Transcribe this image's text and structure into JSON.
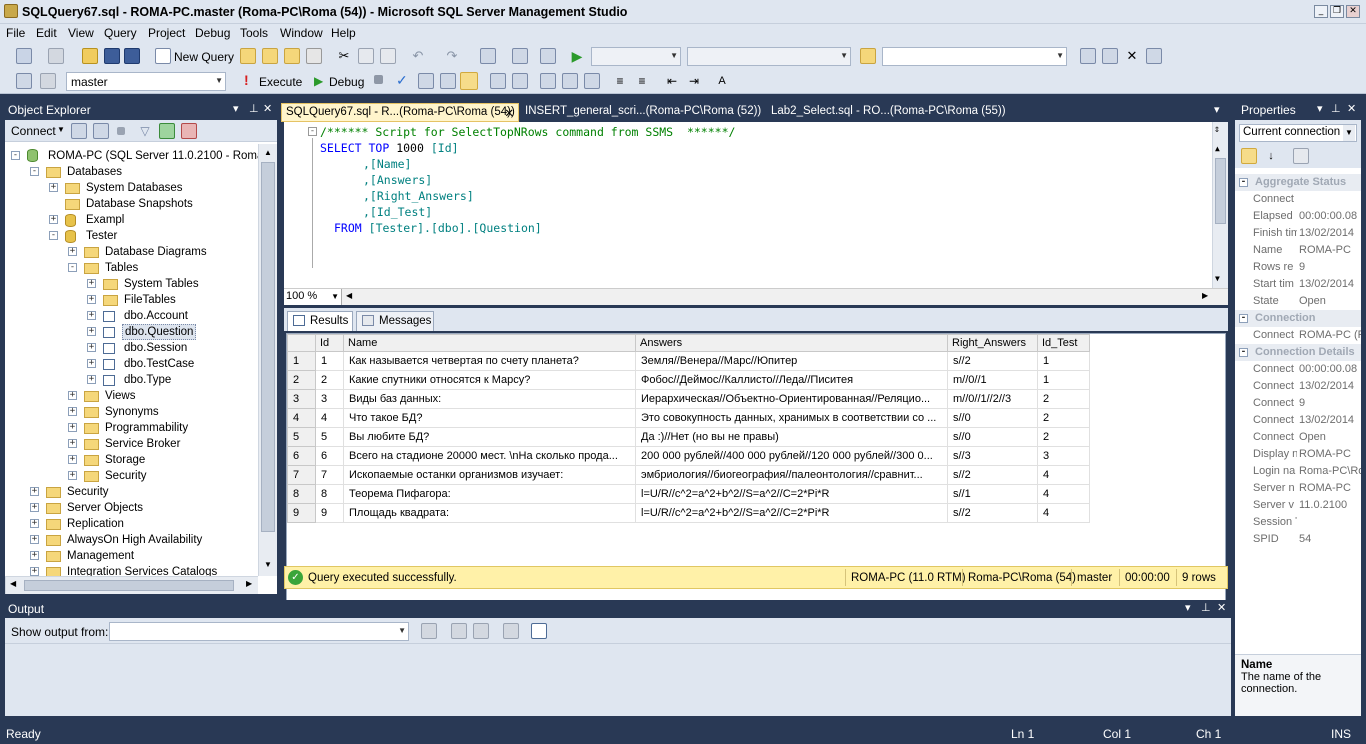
{
  "window": {
    "title": "SQLQuery67.sql - ROMA-PC.master (Roma-PC\\Roma (54)) - Microsoft SQL Server Management Studio"
  },
  "menu": [
    "File",
    "Edit",
    "View",
    "Query",
    "Project",
    "Debug",
    "Tools",
    "Window",
    "Help"
  ],
  "toolbar": {
    "new_query": "New Query",
    "database": "master",
    "execute": "Execute",
    "debug": "Debug"
  },
  "object_explorer": {
    "title": "Object Explorer",
    "connect": "Connect",
    "tree": [
      {
        "label": "ROMA-PC (SQL Server 11.0.2100 - Roma-P",
        "indent": 0,
        "exp": "-",
        "icon": "server"
      },
      {
        "label": "Databases",
        "indent": 1,
        "exp": "-",
        "icon": "folder"
      },
      {
        "label": "System Databases",
        "indent": 2,
        "exp": "+",
        "icon": "folder"
      },
      {
        "label": "Database Snapshots",
        "indent": 2,
        "exp": "",
        "icon": "folder"
      },
      {
        "label": "Exampl",
        "indent": 2,
        "exp": "+",
        "icon": "db"
      },
      {
        "label": "Tester",
        "indent": 2,
        "exp": "-",
        "icon": "db"
      },
      {
        "label": "Database Diagrams",
        "indent": 3,
        "exp": "+",
        "icon": "folder"
      },
      {
        "label": "Tables",
        "indent": 3,
        "exp": "-",
        "icon": "folder"
      },
      {
        "label": "System Tables",
        "indent": 4,
        "exp": "+",
        "icon": "folder"
      },
      {
        "label": "FileTables",
        "indent": 4,
        "exp": "+",
        "icon": "folder"
      },
      {
        "label": "dbo.Account",
        "indent": 4,
        "exp": "+",
        "icon": "table"
      },
      {
        "label": "dbo.Question",
        "indent": 4,
        "exp": "+",
        "icon": "table",
        "selected": true
      },
      {
        "label": "dbo.Session",
        "indent": 4,
        "exp": "+",
        "icon": "table"
      },
      {
        "label": "dbo.TestCase",
        "indent": 4,
        "exp": "+",
        "icon": "table"
      },
      {
        "label": "dbo.Type",
        "indent": 4,
        "exp": "+",
        "icon": "table"
      },
      {
        "label": "Views",
        "indent": 3,
        "exp": "+",
        "icon": "folder"
      },
      {
        "label": "Synonyms",
        "indent": 3,
        "exp": "+",
        "icon": "folder"
      },
      {
        "label": "Programmability",
        "indent": 3,
        "exp": "+",
        "icon": "folder"
      },
      {
        "label": "Service Broker",
        "indent": 3,
        "exp": "+",
        "icon": "folder"
      },
      {
        "label": "Storage",
        "indent": 3,
        "exp": "+",
        "icon": "folder"
      },
      {
        "label": "Security",
        "indent": 3,
        "exp": "+",
        "icon": "folder"
      },
      {
        "label": "Security",
        "indent": 1,
        "exp": "+",
        "icon": "folder"
      },
      {
        "label": "Server Objects",
        "indent": 1,
        "exp": "+",
        "icon": "folder"
      },
      {
        "label": "Replication",
        "indent": 1,
        "exp": "+",
        "icon": "folder"
      },
      {
        "label": "AlwaysOn High Availability",
        "indent": 1,
        "exp": "+",
        "icon": "folder"
      },
      {
        "label": "Management",
        "indent": 1,
        "exp": "+",
        "icon": "folder"
      },
      {
        "label": "Integration Services Catalogs",
        "indent": 1,
        "exp": "+",
        "icon": "folder"
      }
    ]
  },
  "tabs": [
    {
      "label": "SQLQuery67.sql - R...(Roma-PC\\Roma (54))",
      "active": true
    },
    {
      "label": "INSERT_general_scri...(Roma-PC\\Roma (52))",
      "active": false
    },
    {
      "label": "Lab2_Select.sql - RO...(Roma-PC\\Roma (55))",
      "active": false
    }
  ],
  "editor": {
    "comment": "/****** Script for SelectTopNRows command from SSMS  ******/",
    "line1_kw1": "SELECT",
    "line1_kw2": "TOP",
    "line1_num": "1000",
    "line1_col": "[Id]",
    "col2": ",[Name]",
    "col3": ",[Answers]",
    "col4": ",[Right_Answers]",
    "col5": ",[Id_Test]",
    "from_kw": "FROM",
    "from_obj": "[Tester].[dbo].[Question]",
    "zoom": "100 %"
  },
  "results": {
    "tab_results": "Results",
    "tab_messages": "Messages",
    "columns": [
      "Id",
      "Name",
      "Answers",
      "Right_Answers",
      "Id_Test"
    ],
    "rows": [
      [
        "1",
        "1",
        "Как называется четвертая по счету планета?",
        "Земля//Венера//Марс//Юпитер",
        "s//2",
        "1"
      ],
      [
        "2",
        "2",
        "Какие спутники относятся к Марсу?",
        "Фобос//Деймос//Каллисто//Леда//Писитея",
        "m//0//1",
        "1"
      ],
      [
        "3",
        "3",
        "Виды баз данных:",
        "Иерархическая//Объектно-Ориентированная//Реляцио...",
        "m//0//1//2//3",
        "2"
      ],
      [
        "4",
        "4",
        "Что такое БД?",
        "Это совокупность данных, хранимых в соответствии со ...",
        "s//0",
        "2"
      ],
      [
        "5",
        "5",
        "Вы любите БД?",
        "Да :)//Нет (но вы не правы)",
        "s//0",
        "2"
      ],
      [
        "6",
        "6",
        "Всего на стадионе 20000 мест. \\nНа сколько прода...",
        "200 000 рублей//400 000 рублей//120 000 рублей//300 0...",
        "s//3",
        "3"
      ],
      [
        "7",
        "7",
        "Ископаемые останки организмов изучает:",
        "эмбриология//биогеография//палеонтология//сравнит...",
        "s//2",
        "4"
      ],
      [
        "8",
        "8",
        "Теорема Пифагора:",
        "l=U/R//c^2=a^2+b^2//S=a^2//C=2*Pi*R",
        "s//1",
        "4"
      ],
      [
        "9",
        "9",
        "Площадь квадрата:",
        "l=U/R//c^2=a^2+b^2//S=a^2//C=2*Pi*R",
        "s//2",
        "4"
      ]
    ]
  },
  "query_status": {
    "message": "Query executed successfully.",
    "server": "ROMA-PC (11.0 RTM)",
    "user": "Roma-PC\\Roma (54)",
    "db": "master",
    "time": "00:00:00",
    "rows": "9 rows"
  },
  "properties": {
    "title": "Properties",
    "selector": "Current connection p",
    "cat1": "Aggregate Status",
    "cat2": "Connection",
    "cat3": "Connection Details",
    "agg": [
      [
        "Connect",
        ""
      ],
      [
        "Elapsed",
        "00:00:00.08"
      ],
      [
        "Finish tim",
        "13/02/2014"
      ],
      [
        "Name",
        "ROMA-PC"
      ],
      [
        "Rows re",
        "9"
      ],
      [
        "Start tim",
        "13/02/2014"
      ],
      [
        "State",
        "Open"
      ]
    ],
    "conn": [
      [
        "Connect",
        "ROMA-PC (R"
      ]
    ],
    "details": [
      [
        "Connect",
        "00:00:00.08"
      ],
      [
        "Connect",
        "13/02/2014"
      ],
      [
        "Connect",
        "9"
      ],
      [
        "Connect",
        "13/02/2014"
      ],
      [
        "Connect",
        "Open"
      ],
      [
        "Display n",
        "ROMA-PC"
      ],
      [
        "Login na",
        "Roma-PC\\Ro"
      ],
      [
        "Server n",
        "ROMA-PC"
      ],
      [
        "Server v",
        "11.0.2100"
      ],
      [
        "Session T",
        ""
      ],
      [
        "SPID",
        "54"
      ]
    ],
    "desc_title": "Name",
    "desc_text": "The name of the connection."
  },
  "output": {
    "title": "Output",
    "show_from": "Show output from:"
  },
  "statusbar": {
    "ready": "Ready",
    "ln": "Ln 1",
    "col": "Col 1",
    "ch": "Ch 1",
    "ins": "INS"
  }
}
